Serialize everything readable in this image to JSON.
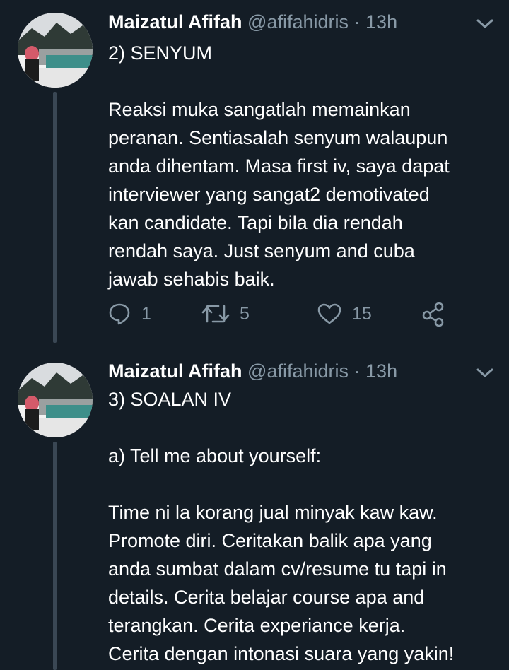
{
  "colors": {
    "background": "#141d26",
    "text": "#ffffff",
    "muted": "#8899a6",
    "thread_line": "#3a4754"
  },
  "tweets": [
    {
      "display_name": "Maizatul Afifah",
      "handle": "@afifahidris",
      "separator": "·",
      "time": "13h",
      "body": "2) SENYUM\n\nReaksi muka sangatlah memainkan\nperanan. Sentiasalah senyum walaupun\nanda dihentam. Masa first iv, saya dapat\ninterviewer yang sangat2 demotivated\nkan candidate. Tapi bila dia rendah\nrendah saya. Just senyum and cuba\njawab sehabis baik.",
      "actions": {
        "reply_icon": "reply-icon",
        "reply_count": "1",
        "retweet_icon": "retweet-icon",
        "retweet_count": "5",
        "like_icon": "heart-icon",
        "like_count": "15",
        "share_icon": "share-icon"
      }
    },
    {
      "display_name": "Maizatul Afifah",
      "handle": "@afifahidris",
      "separator": "·",
      "time": "13h",
      "body": "3) SOALAN IV\n\na) Tell me about yourself:\n\nTime ni la korang jual minyak kaw kaw.\nPromote diri. Ceritakan balik apa yang\nanda sumbat dalam cv/resume tu tapi in\ndetails. Cerita belajar course apa and\nterangkan. Cerita experiance kerja.\nCerita dengan intonasi suara yang yakin!"
    }
  ]
}
